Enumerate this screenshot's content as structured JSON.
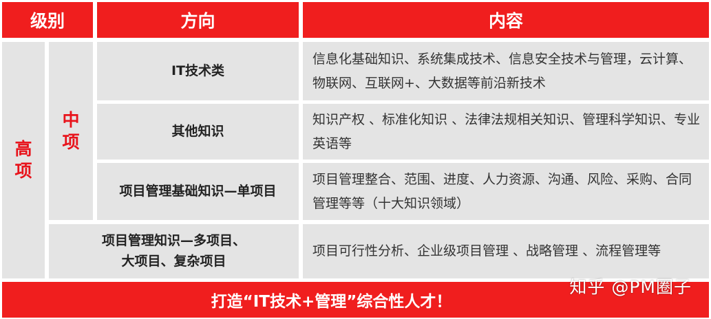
{
  "header": {
    "col_level": "级别",
    "col_direction": "方向",
    "col_content": "内容"
  },
  "levels": {
    "high": [
      "高",
      "项"
    ],
    "medium": [
      "中",
      "项"
    ]
  },
  "rows": [
    {
      "direction": "IT技术类",
      "content": "信息化基础知识、系统集成技术、信息安全技术与管理，云计算、物联网、互联网+、大数据等前沿新技术"
    },
    {
      "direction": "其他知识",
      "content": "知识产权 、标准化知识 、法律法规相关知识、管理科学知识、专业英语等"
    },
    {
      "direction": "项目管理基础知识—单项目",
      "content": "项目管理整合、范围、进度、人力资源、沟通、风险、采购、合同管理等等（十大知识领域）"
    },
    {
      "direction_lines": [
        "项目管理知识—多项目、",
        "大项目、复杂项目"
      ],
      "content": "项目可行性分析、企业级项目管理 、战略管理 、流程管理等"
    }
  ],
  "banner": "打造“IT技术+管理”综合性人才！",
  "watermark": "知乎 @PM圈子",
  "colors": {
    "accent_red": "#f01e1e",
    "level_text_red": "#e8131b",
    "cell_gray": "#e4e4e4"
  }
}
